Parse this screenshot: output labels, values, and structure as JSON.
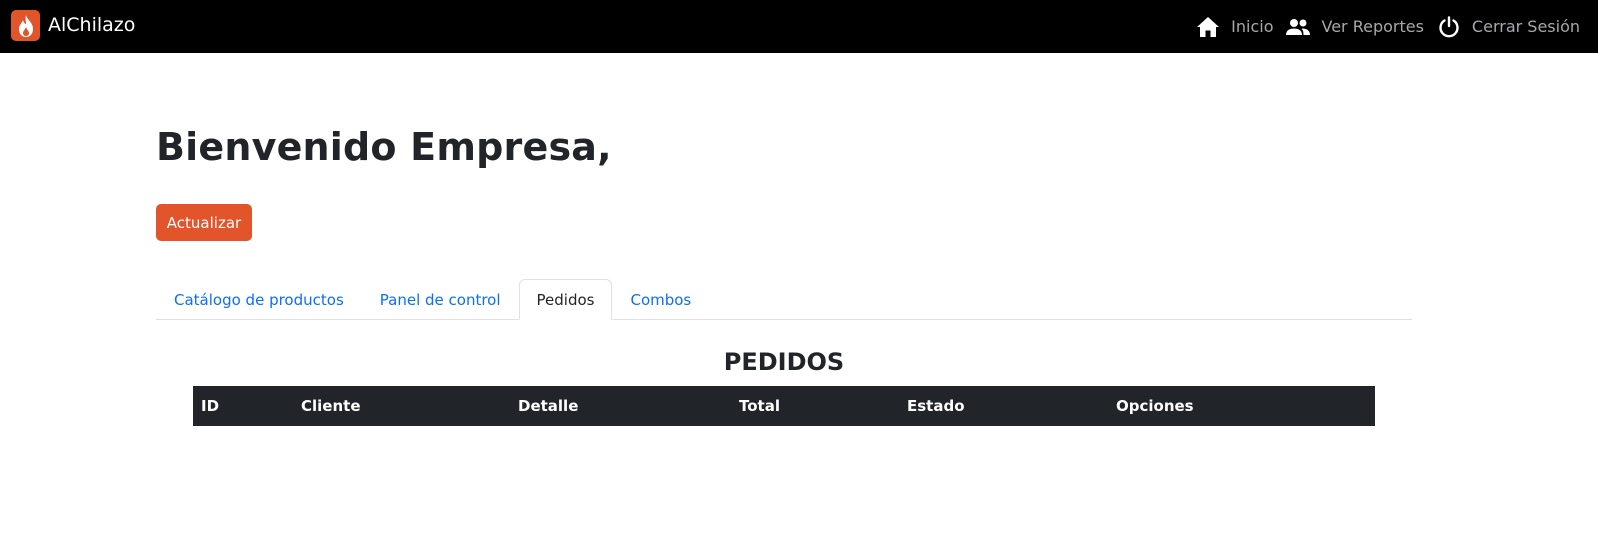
{
  "navbar": {
    "brand": "AlChilazo",
    "links": [
      {
        "label": "Inicio",
        "icon": "home-icon"
      },
      {
        "label": "Ver Reportes",
        "icon": "people-icon"
      },
      {
        "label": "Cerrar Sesión",
        "icon": "power-icon"
      }
    ]
  },
  "main": {
    "welcome": "Bienvenido Empresa,",
    "update_button": "Actualizar",
    "tabs": [
      {
        "label": "Catálogo de productos",
        "active": false
      },
      {
        "label": "Panel de control",
        "active": false
      },
      {
        "label": "Pedidos",
        "active": true
      },
      {
        "label": "Combos",
        "active": false
      }
    ],
    "section_title": "PEDIDOS",
    "table": {
      "columns": [
        "ID",
        "Cliente",
        "Detalle",
        "Total",
        "Estado",
        "Opciones"
      ],
      "rows": []
    }
  },
  "colors": {
    "accent": "#e2542a",
    "navbar": "#000000",
    "link": "#0d6efd",
    "table_header": "#212529"
  }
}
